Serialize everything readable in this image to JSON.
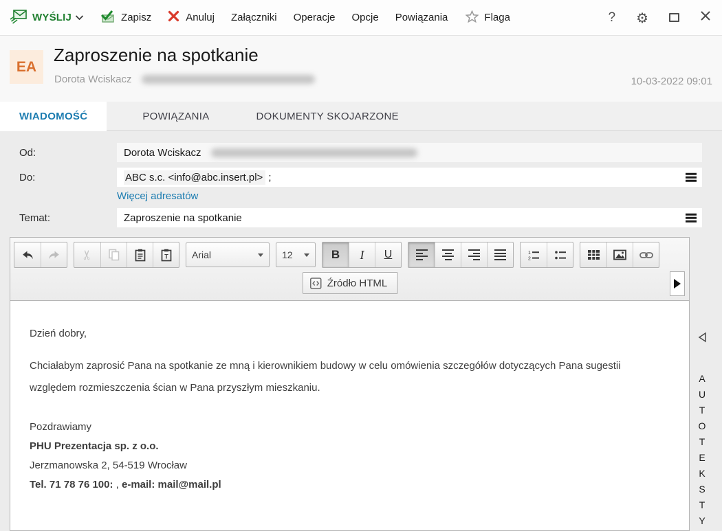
{
  "toolbar": {
    "send_label": "WYŚLIJ",
    "save_label": "Zapisz",
    "cancel_label": "Anuluj",
    "menu": [
      "Załączniki",
      "Operacje",
      "Opcje",
      "Powiązania"
    ],
    "flag_label": "Flaga",
    "help_label": "?",
    "gear_glyph": "⚙"
  },
  "header": {
    "avatar_initials": "EA",
    "title": "Zaproszenie na spotkanie",
    "sender_name": "Dorota Wciskacz",
    "datetime": "10-03-2022 09:01"
  },
  "tabs": [
    {
      "label": "WIADOMOŚĆ",
      "active": true
    },
    {
      "label": "POWIĄZANIA",
      "active": false
    },
    {
      "label": "DOKUMENTY SKOJARZONE",
      "active": false
    }
  ],
  "form": {
    "from_label": "Od:",
    "from_value": "Dorota Wciskacz",
    "to_label": "Do:",
    "to_value": "ABC s.c. <info@abc.insert.pl>",
    "to_suffix": ";",
    "more_recipients_link": "Więcej adresatów",
    "subject_label": "Temat:",
    "subject_value": "Zaproszenie na spotkanie"
  },
  "editor": {
    "font_family": "Arial",
    "font_size": "12",
    "bold_glyph": "B",
    "italic_glyph": "I",
    "underline_glyph": "U",
    "source_button_label": "Źródło HTML",
    "body": {
      "greeting": "Dzień dobry,",
      "paragraph": "Chciałabym zaprosić Pana na spotkanie ze mną i kierownikiem budowy w celu omówienia szczegółów dotyczących Pana sugestii względem rozmieszczenia ścian w Pana przyszłym mieszkaniu.",
      "closing": "Pozdrawiamy",
      "company": "PHU Prezentacja sp. z o.o.",
      "address": "Jerzmanowska 2, 54-519 Wrocław",
      "phone_bold": "Tel. 71 78 76 100:",
      "phone_sep": " , ",
      "email_bold": "e-mail: mail@mail.pl"
    }
  },
  "side_panel": {
    "label": "AUTOTEKSTY"
  },
  "colors": {
    "accent_green": "#1e7e2e",
    "accent_red": "#d93a2b",
    "accent_blue": "#1c7cb0",
    "avatar_bg": "#fcecdd",
    "avatar_text": "#d9702e",
    "content_bg": "#ececec"
  }
}
